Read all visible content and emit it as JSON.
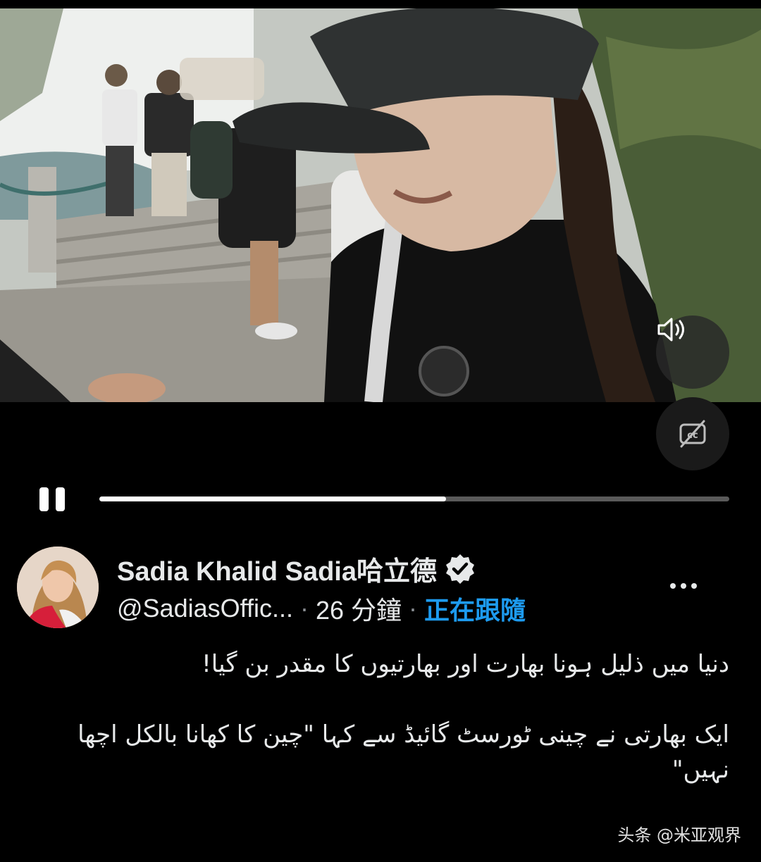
{
  "player": {
    "progress": 0.55,
    "mute_icon": "speaker-icon",
    "cc_icon": "captions-off-icon",
    "pause_icon": "pause-icon"
  },
  "author": {
    "display_name": "Sadia Khalid Sadia哈立德",
    "handle": "@SadiasOffic...",
    "separator": "·",
    "time_ago": "26 分鐘",
    "follow_status": "正在跟隨",
    "verified_icon": "verified-badge-icon"
  },
  "post": {
    "line1": "دنیا میں ذلیل ہونا بھارت اور بھارتیوں کا مقدر بن گیا!",
    "line2": "ایک بھارتی نے چینی ٹورسٹ گائیڈ سے کہا \"چین کا کھانا بالکل اچھا نہیں\""
  },
  "watermark": "头条 @米亚观界",
  "colors": {
    "background": "#000000",
    "accent": "#1d9bf0",
    "text": "#e7e9ea"
  }
}
